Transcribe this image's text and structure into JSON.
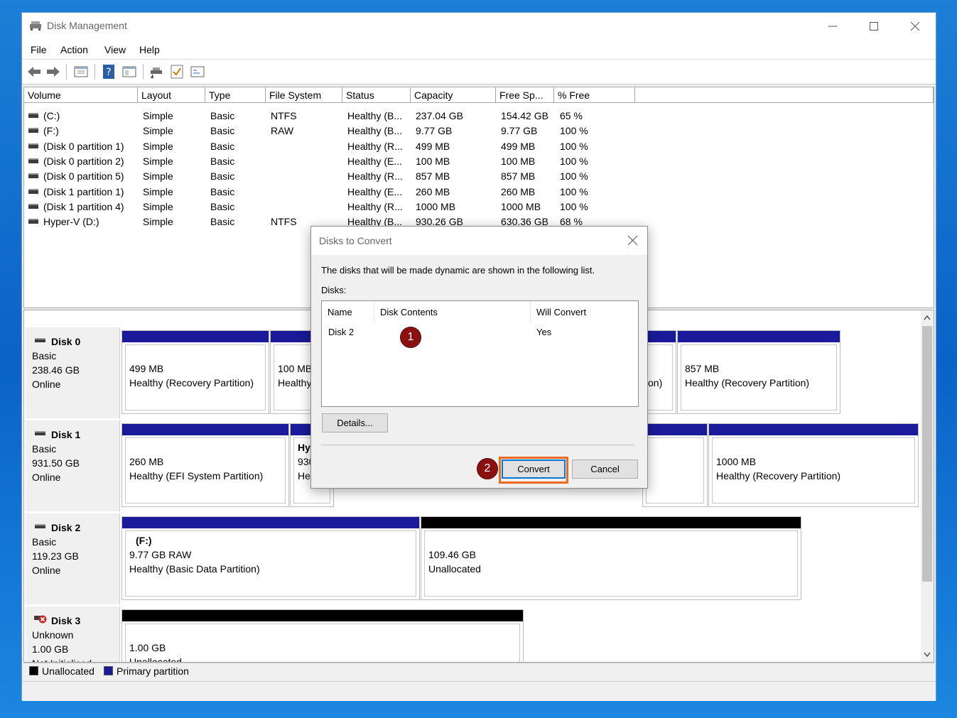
{
  "window": {
    "title": "Disk Management"
  },
  "menu": {
    "file": "File",
    "action": "Action",
    "view": "View",
    "help": "Help"
  },
  "toolbar_icons": [
    "back-arrow-icon",
    "forward-arrow-icon",
    "properties-icon",
    "help-icon",
    "console-icon",
    "connect-icon",
    "check-icon",
    "settings-icon"
  ],
  "volume_table": {
    "columns": [
      "Volume",
      "Layout",
      "Type",
      "File System",
      "Status",
      "Capacity",
      "Free Sp...",
      "% Free"
    ],
    "rows": [
      [
        "(C:)",
        "Simple",
        "Basic",
        "NTFS",
        "Healthy (B...",
        "237.04 GB",
        "154.42 GB",
        "65 %"
      ],
      [
        "(F:)",
        "Simple",
        "Basic",
        "RAW",
        "Healthy (B...",
        "9.77 GB",
        "9.77 GB",
        "100 %"
      ],
      [
        "(Disk 0 partition 1)",
        "Simple",
        "Basic",
        "",
        "Healthy (R...",
        "499 MB",
        "499 MB",
        "100 %"
      ],
      [
        "(Disk 0 partition 2)",
        "Simple",
        "Basic",
        "",
        "Healthy (E...",
        "100 MB",
        "100 MB",
        "100 %"
      ],
      [
        "(Disk 0 partition 5)",
        "Simple",
        "Basic",
        "",
        "Healthy (R...",
        "857 MB",
        "857 MB",
        "100 %"
      ],
      [
        "(Disk 1 partition 1)",
        "Simple",
        "Basic",
        "",
        "Healthy (E...",
        "260 MB",
        "260 MB",
        "100 %"
      ],
      [
        "(Disk 1 partition 4)",
        "Simple",
        "Basic",
        "",
        "Healthy (R...",
        "1000 MB",
        "1000 MB",
        "100 %"
      ],
      [
        "Hyper-V (D:)",
        "Simple",
        "Basic",
        "NTFS",
        "Healthy (B...",
        "930.26 GB",
        "630.36 GB",
        "68 %"
      ]
    ]
  },
  "disks": [
    {
      "name": "Disk 0",
      "type": "Basic",
      "size": "238.46 GB",
      "state": "Online",
      "partitions": [
        {
          "line1": "",
          "line2": "499 MB",
          "line3": "Healthy (Recovery Partition)"
        },
        {
          "line1": "",
          "line2": "100 MB",
          "line3": "Healthy"
        },
        {
          "line1": "",
          "line2": "",
          "line3": "on)"
        },
        {
          "line1": "",
          "line2": "857 MB",
          "line3": "Healthy (Recovery Partition)"
        }
      ]
    },
    {
      "name": "Disk 1",
      "type": "Basic",
      "size": "931.50 GB",
      "state": "Online",
      "partitions": [
        {
          "line1": "",
          "line2": "260 MB",
          "line3": "Healthy (EFI System Partition)"
        },
        {
          "line1": "Hy",
          "line2": "930",
          "line3": "He"
        },
        {
          "line1": "",
          "line2": "",
          "line3": ""
        },
        {
          "line1": "",
          "line2": "1000 MB",
          "line3": "Healthy (Recovery Partition)"
        }
      ]
    },
    {
      "name": "Disk 2",
      "type": "Basic",
      "size": "119.23 GB",
      "state": "Online",
      "partitions": [
        {
          "line1": "(F:)",
          "line2": "9.77 GB RAW",
          "line3": "Healthy (Basic Data Partition)"
        },
        {
          "line1": "",
          "line2": "109.46 GB",
          "line3": "Unallocated"
        }
      ]
    },
    {
      "name": "Disk 3",
      "type": "Unknown",
      "size": "1.00 GB",
      "state": "Not Initialised",
      "partitions": [
        {
          "line1": "",
          "line2": "1.00 GB",
          "line3": "Unallocated"
        }
      ]
    }
  ],
  "legend": {
    "unallocated": "Unallocated",
    "primary": "Primary partition"
  },
  "colors": {
    "primary": "#1a1a9a",
    "unallocated": "#000000",
    "highlight": "#f06a1e",
    "callout": "#8b1010"
  },
  "dialog": {
    "title": "Disks to Convert",
    "info": "The disks that will be made dynamic are shown in the following list.",
    "disks_label": "Disks:",
    "columns": [
      "Name",
      "Disk Contents",
      "Will Convert"
    ],
    "rows": [
      [
        "Disk 2",
        "",
        "Yes"
      ]
    ],
    "details_button": "Details...",
    "convert_button": "Convert",
    "cancel_button": "Cancel"
  },
  "callouts": [
    "1",
    "2"
  ]
}
